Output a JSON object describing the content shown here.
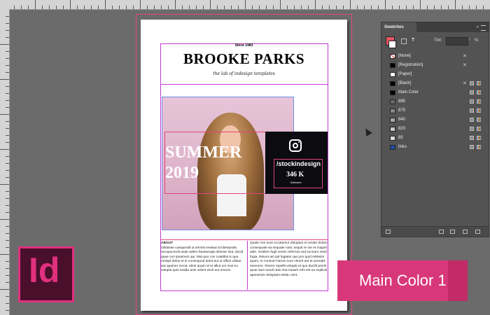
{
  "document": {
    "since": "Since 1983",
    "title": "BROOKE PARKS",
    "tagline": "the lab of indesign templates",
    "hero_text_line1": "SUMMER",
    "hero_text_line2": "2019",
    "instagram": {
      "handle": "/stockindesign",
      "followers_count": "346 K",
      "followers_label": "followers"
    },
    "columns": {
      "left_heading": "ABOUT",
      "left_text": "Obitasse caequindit ut amnist evelaut id idempedis excopucendi ande adere beartunqat dolorae stut, ducid quae con ipsamum qui. Mat quo con cuiatibis is qua molupt dolos et in consequod dolut aut ut offact ulitaut aut quamer necat. Idest quam id et alliut uni mus ex volupta quis sedda anis volunt escil aut omrom.",
      "right_text": "Quate non sunt occatemur doluptus et verate dolore consequate sa sequate nost, sequit re nie et magnit adis. Ovidem fugit venim referrum aut excearo resiti fugia. Reiunt am ipit fugiatur quo pro quid mitissim quam, to consum harum sum cleorit aut et aceratis eserume. Rioren repellit volupta et quo ducilit preris quae sam sundi ratio ima nusam rehi est ea expliciti apenescle doluptam.stelia, mint."
    }
  },
  "swatches_panel": {
    "tab_title": "Swatches",
    "tint_label": "Tint:",
    "tint_value": "",
    "tint_unit": "%",
    "stroke_fill_text_label": "T",
    "fill_color": "#e35563",
    "swatches": [
      {
        "name": "[None]",
        "color": "#ffffff"
      },
      {
        "name": "[Registration]",
        "color": "#000000"
      },
      {
        "name": "[Paper]",
        "color": "#ffffff"
      },
      {
        "name": "[Black]",
        "color": "#000000"
      },
      {
        "name": "Main Color",
        "color": "#000000"
      },
      {
        "name": "885",
        "color": "#6a6a6a"
      },
      {
        "name": "875",
        "color": "#8a8a8a"
      },
      {
        "name": "840",
        "color": "#a8a8a8"
      },
      {
        "name": "820",
        "color": "#c8c8c8"
      },
      {
        "name": "85",
        "color": "#e0e0e0"
      },
      {
        "name": "links",
        "color": "#1f4fa0"
      }
    ]
  },
  "badge": {
    "text": "Main Color 1",
    "color": "#d8387a"
  },
  "app_logo": {
    "text": "Id",
    "color": "#e0307e"
  }
}
